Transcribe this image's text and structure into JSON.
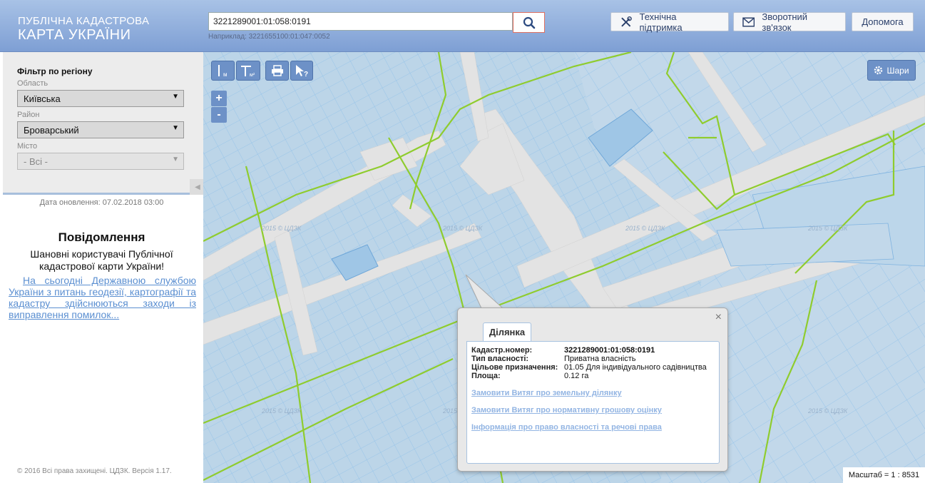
{
  "header": {
    "logo_line1": "ПУБЛІЧНА КАДАСТРОВА",
    "logo_line2": "КАРТА УКРАЇНИ",
    "search_value": "3221289001:01:058:0191",
    "search_hint": "Наприклад: 3221655100:01:047:0052",
    "buttons": {
      "support": "Технічна підтримка",
      "feedback": "Зворотний зв'язок",
      "help": "Допомога"
    }
  },
  "sidebar": {
    "filter_title": "Фільтр по регіону",
    "oblast_label": "Область",
    "oblast_value": "Київська",
    "rayon_label": "Район",
    "rayon_value": "Броварський",
    "city_label": "Місто",
    "city_value": "- Всі -",
    "update_date": "Дата оновлення: 07.02.2018 03:00",
    "notice_title": "Повідомлення",
    "notice_body": "Шановні користувачі Публічної кадастрової карти України!",
    "notice_link": "На сьогодні Державною службою України з питань геодезії, картографії та кадастру здійснюються заходи із виправлення помилок...",
    "copyright": "© 2016 Всі права захищені. ЦДЗК. Версія 1.17."
  },
  "map": {
    "layers_label": "Шари",
    "zoom_in": "+",
    "zoom_out": "-",
    "scale": "Масштаб = 1 : 8531",
    "watermark": "2015 © ЦДЗК"
  },
  "popup": {
    "tab": "Ділянка",
    "close": "×",
    "rows": [
      {
        "key": "Кадастр.номер:",
        "value": "3221289001:01:058:0191"
      },
      {
        "key": "Тип власності:",
        "value": "Приватна власність"
      },
      {
        "key": "Цільове призначення:",
        "value": "01.05 Для індивідуального садівництва"
      },
      {
        "key": "Площа:",
        "value": "0.12 га"
      }
    ],
    "links": [
      "Замовити Витяг про земельну ділянку",
      "Замовити Витяг про нормативну грошову оцінку",
      "Інформація про право власності та речові права"
    ]
  },
  "colors": {
    "header": "#8aa8d9",
    "parcel_fill": "#bcd5e8",
    "parcel_stroke": "#7fb3e0",
    "road": "#e3e3e3",
    "boundary": "#8fcc2e",
    "button": "#6d91c7"
  }
}
